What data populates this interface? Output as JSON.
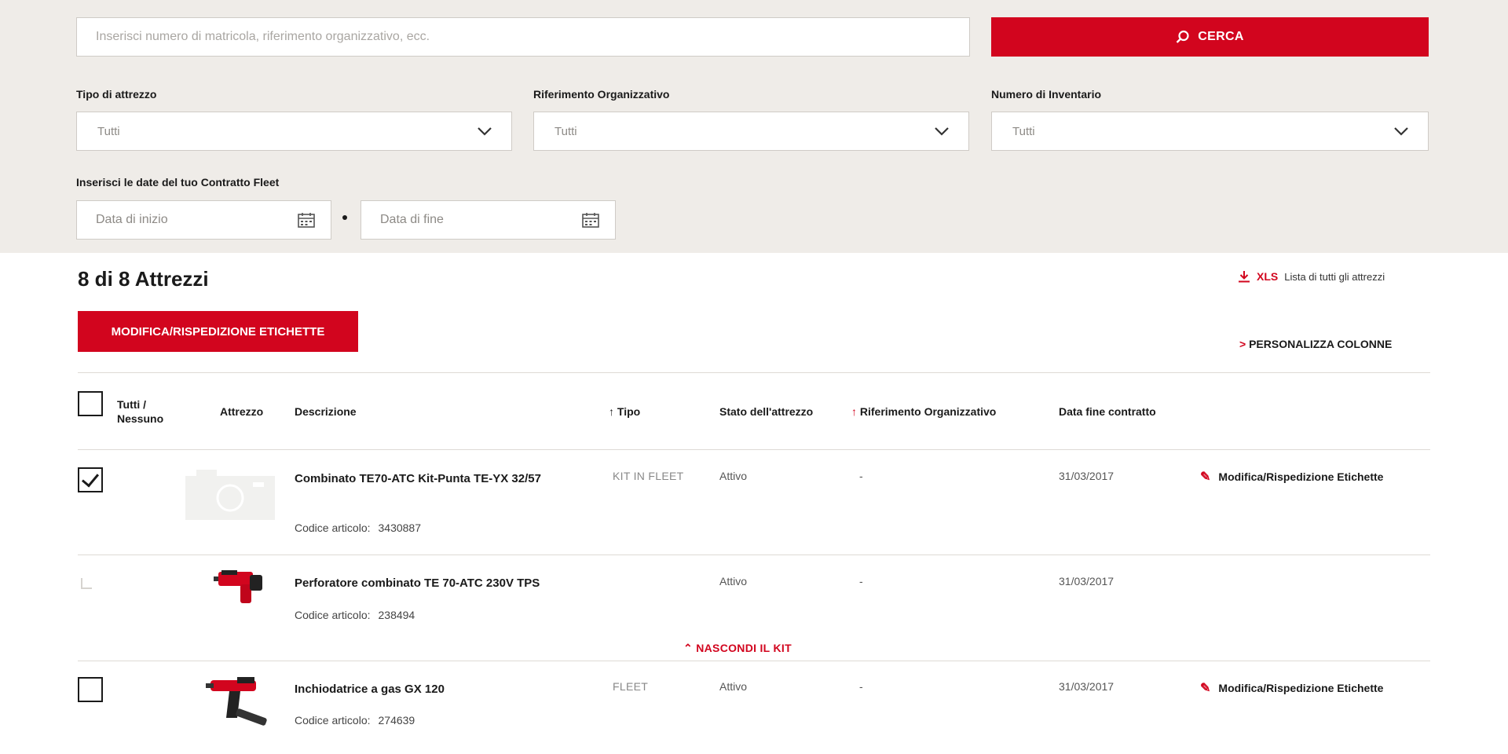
{
  "search": {
    "placeholder": "Inserisci numero di matricola, riferimento organizzativo, ecc.",
    "button_label": "CERCA"
  },
  "filters": {
    "tool_type": {
      "label": "Tipo di attrezzo",
      "value": "Tutti"
    },
    "org_ref": {
      "label": "Riferimento Organizzativo",
      "value": "Tutti"
    },
    "inventory": {
      "label": "Numero di Inventario",
      "value": "Tutti"
    },
    "dates": {
      "label": "Inserisci le date del tuo Contratto Fleet",
      "start_placeholder": "Data di inizio",
      "end_placeholder": "Data di fine"
    }
  },
  "results": {
    "count_label": "8 di 8 Attrezzi",
    "xls_label": "XLS",
    "xls_text": "Lista di tutti gli attrezzi",
    "edit_button": "MODIFICA/RISPEDIZIONE ETICHETTE",
    "customize_arrow": ">",
    "customize_label": "PERSONALIZZA COLONNE"
  },
  "table": {
    "headers": {
      "select_all": "Tutti / Nessuno",
      "tool": "Attrezzo",
      "description": "Descrizione",
      "type": "Tipo",
      "status": "Stato dell'attrezzo",
      "org_ref": "Riferimento Organizzativo",
      "end_date": "Data fine contratto"
    },
    "code_label": "Codice articolo:",
    "rows": [
      {
        "description": "Combinato TE70-ATC Kit-Punta TE-YX 32/57",
        "code": "3430887",
        "type": "KIT IN FLEET",
        "status": "Attivo",
        "org_ref": "-",
        "end_date": "31/03/2017",
        "action": "Modifica/Rispedizione Etichette",
        "checked": true
      },
      {
        "description": "Perforatore combinato TE 70-ATC 230V TPS",
        "code": "238494",
        "type": "",
        "status": "Attivo",
        "org_ref": "-",
        "end_date": "31/03/2017",
        "action": "",
        "checked": false
      },
      {
        "description": "Inchiodatrice a gas GX 120",
        "code": "274639",
        "type": "FLEET",
        "status": "Attivo",
        "org_ref": "-",
        "end_date": "31/03/2017",
        "action": "Modifica/Rispedizione Etichette",
        "checked": false
      }
    ],
    "hide_kit": "NASCONDI IL KIT"
  },
  "colors": {
    "brand_red": "#d2051e",
    "panel_bg": "#efece8"
  },
  "icons": [
    "search-icon",
    "chevron-down-icon",
    "calendar-icon",
    "download-icon",
    "pen-icon",
    "chevron-up-icon"
  ]
}
